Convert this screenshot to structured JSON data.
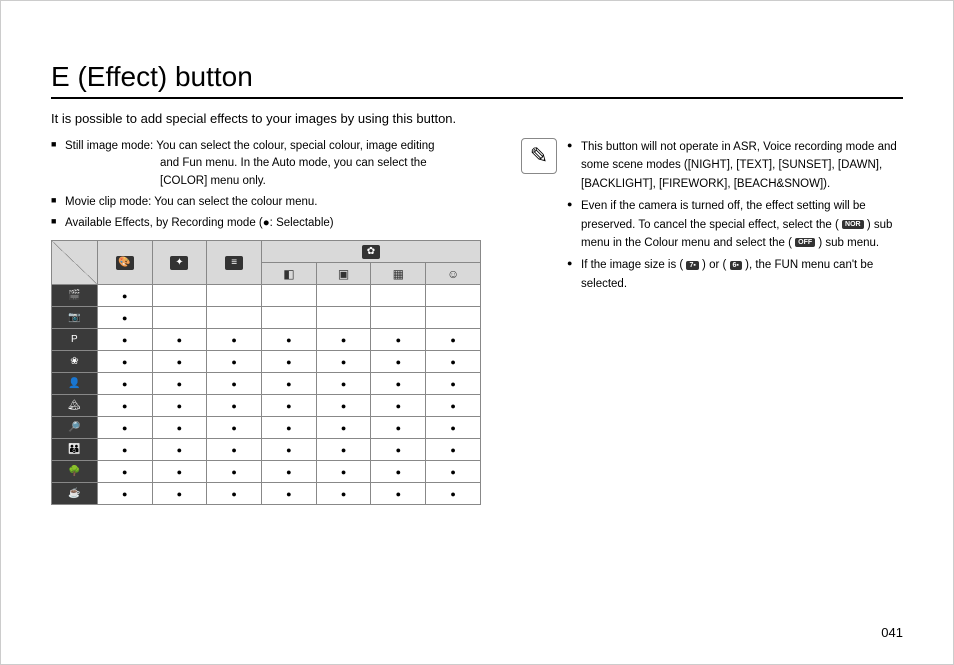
{
  "title": "E (Effect) button",
  "intro": "It is possible to add special effects to your images by using this button.",
  "left": {
    "bullets": {
      "b1_label": "Still image mode:",
      "b1_text": "You can select the colour, special colour, image editing",
      "b1_line2": "and Fun menu. In the Auto mode, you can select the",
      "b1_line3": "[COLOR] menu only.",
      "b2": "Movie clip mode: You can select the colour menu.",
      "b3": "Available Effects, by Recording mode (●: Selectable)"
    }
  },
  "right": {
    "r1": "This button will not operate in ASR, Voice recording mode and some scene modes ([NIGHT], [TEXT], [SUNSET], [DAWN], [BACKLIGHT], [FIREWORK], [BEACH&SNOW]).",
    "r2a": "Even if the camera is turned off, the effect setting will be preserved. To cancel the special effect, select the (",
    "r2_label1": "NOR",
    "r2b": ") sub menu in the Colour menu and select the (",
    "r2_label2": "OFF",
    "r2c": ") sub menu.",
    "r3a": "If the image size is (",
    "r3b": ") or (",
    "r3c": "), the FUN menu can't be selected."
  },
  "table": {
    "cols": [
      "palette",
      "sparkle",
      "adjust",
      "fun-dark",
      "fun-frame",
      "fun-mosaic",
      "fun-face"
    ],
    "rows": [
      {
        "mode": "movie",
        "sel": [
          1,
          0,
          0,
          0,
          0,
          0,
          0
        ]
      },
      {
        "mode": "camera",
        "sel": [
          1,
          0,
          0,
          0,
          0,
          0,
          0
        ]
      },
      {
        "mode": "program",
        "sel": [
          1,
          1,
          1,
          1,
          1,
          1,
          1
        ]
      },
      {
        "mode": "macro",
        "sel": [
          1,
          1,
          1,
          1,
          1,
          1,
          1
        ]
      },
      {
        "mode": "portrait",
        "sel": [
          1,
          1,
          1,
          1,
          1,
          1,
          1
        ]
      },
      {
        "mode": "landscape",
        "sel": [
          1,
          1,
          1,
          1,
          1,
          1,
          1
        ]
      },
      {
        "mode": "closeup",
        "sel": [
          1,
          1,
          1,
          1,
          1,
          1,
          1
        ]
      },
      {
        "mode": "children",
        "sel": [
          1,
          1,
          1,
          1,
          1,
          1,
          1
        ]
      },
      {
        "mode": "forest",
        "sel": [
          1,
          1,
          1,
          1,
          1,
          1,
          1
        ]
      },
      {
        "mode": "cafe",
        "sel": [
          1,
          1,
          1,
          1,
          1,
          1,
          1
        ]
      }
    ]
  },
  "page_num": "041",
  "icon_glyphs": {
    "palette": "🎨",
    "sparkle": "✦",
    "adjust": "≡",
    "fun": "✿",
    "fun-dark": "◧",
    "fun-frame": "▣",
    "fun-mosaic": "▦",
    "fun-face": "☺",
    "movie": "🎬",
    "camera": "📷",
    "program": "P",
    "macro": "❀",
    "portrait": "👤",
    "landscape": "🏔",
    "closeup": "🔎",
    "children": "👪",
    "forest": "🌳",
    "cafe": "☕",
    "pen": "✎",
    "size7": "7▪",
    "size6": "6▪"
  }
}
